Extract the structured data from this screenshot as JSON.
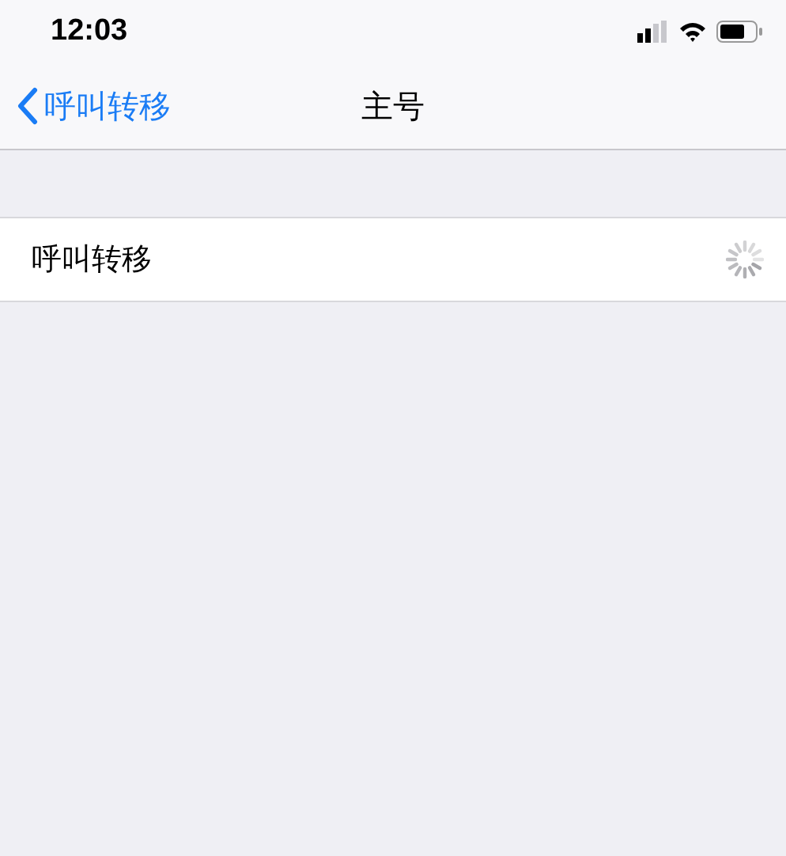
{
  "status_bar": {
    "time": "12:03"
  },
  "nav_bar": {
    "back_label": "呼叫转移",
    "title": "主号"
  },
  "rows": [
    {
      "label": "呼叫转移",
      "loading": true
    }
  ]
}
